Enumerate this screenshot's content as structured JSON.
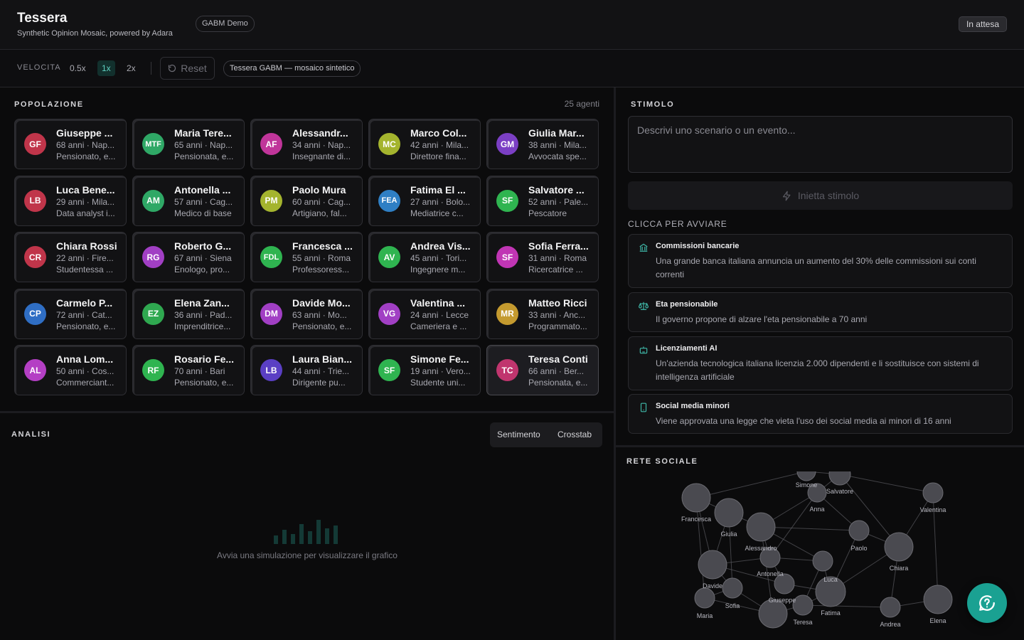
{
  "header": {
    "title": "Tessera",
    "subtitle": "Synthetic Opinion Mosaic, powered by Adara",
    "badge": "GABM Demo",
    "status": "In attesa"
  },
  "toolbar": {
    "speed_label": "VELOCITA",
    "speeds": [
      "0.5x",
      "1x",
      "2x"
    ],
    "active_speed": "1x",
    "reset_label": "Reset",
    "scenario_pill": "Tessera GABM — mosaico sintetico"
  },
  "population": {
    "title": "POPOLAZIONE",
    "count": "25 agenti",
    "agents": [
      {
        "initials": "GF",
        "name": "Giuseppe ...",
        "line1": "68 anni · Nap...",
        "line2": "Pensionato, e...",
        "color": "#c0354a"
      },
      {
        "initials": "MTF",
        "name": "Maria Tere...",
        "line1": "65 anni · Nap...",
        "line2": "Pensionata, e...",
        "color": "#2fa866"
      },
      {
        "initials": "AF",
        "name": "Alessandr...",
        "line1": "34 anni · Nap...",
        "line2": "Insegnante di...",
        "color": "#c0359a"
      },
      {
        "initials": "MC",
        "name": "Marco Col...",
        "line1": "42 anni · Mila...",
        "line2": "Direttore fina...",
        "color": "#a4b42e"
      },
      {
        "initials": "GM",
        "name": "Giulia Mar...",
        "line1": "38 anni · Mila...",
        "line2": "Avvocata spe...",
        "color": "#7b3fc4"
      },
      {
        "initials": "LB",
        "name": "Luca Bene...",
        "line1": "29 anni · Mila...",
        "line2": "Data analyst i...",
        "color": "#c0354a"
      },
      {
        "initials": "AM",
        "name": "Antonella ...",
        "line1": "57 anni · Cag...",
        "line2": "Medico di base",
        "color": "#2fa866"
      },
      {
        "initials": "PM",
        "name": "Paolo Mura",
        "line1": "60 anni · Cag...",
        "line2": "Artigiano, fal...",
        "color": "#a4b42e"
      },
      {
        "initials": "FEA",
        "name": "Fatima El ...",
        "line1": "27 anni · Bolo...",
        "line2": "Mediatrice c...",
        "color": "#2f7fc4"
      },
      {
        "initials": "SF",
        "name": "Salvatore ...",
        "line1": "52 anni · Pale...",
        "line2": "Pescatore",
        "color": "#2fb450"
      },
      {
        "initials": "CR",
        "name": "Chiara Rossi",
        "line1": "22 anni · Fire...",
        "line2": "Studentessa ...",
        "color": "#c0354a"
      },
      {
        "initials": "RG",
        "name": "Roberto G...",
        "line1": "67 anni · Siena",
        "line2": "Enologo, pro...",
        "color": "#a13fc4"
      },
      {
        "initials": "FDL",
        "name": "Francesca ...",
        "line1": "55 anni · Roma",
        "line2": "Professoress...",
        "color": "#2fb450"
      },
      {
        "initials": "AV",
        "name": "Andrea Vis...",
        "line1": "45 anni · Tori...",
        "line2": "Ingegnere m...",
        "color": "#2fb450"
      },
      {
        "initials": "SF",
        "name": "Sofia Ferra...",
        "line1": "31 anni · Roma",
        "line2": "Ricercatrice ...",
        "color": "#c035b4"
      },
      {
        "initials": "CP",
        "name": "Carmelo P...",
        "line1": "72 anni · Cat...",
        "line2": "Pensionato, e...",
        "color": "#2f6ec4"
      },
      {
        "initials": "EZ",
        "name": "Elena Zan...",
        "line1": "36 anni · Pad...",
        "line2": "Imprenditrice...",
        "color": "#2fa850"
      },
      {
        "initials": "DM",
        "name": "Davide Mo...",
        "line1": "63 anni · Mo...",
        "line2": "Pensionato, e...",
        "color": "#a13fc4"
      },
      {
        "initials": "VG",
        "name": "Valentina ...",
        "line1": "24 anni · Lecce",
        "line2": "Cameriera e ...",
        "color": "#a13fc4"
      },
      {
        "initials": "MR",
        "name": "Matteo Ricci",
        "line1": "33 anni · Anc...",
        "line2": "Programmato...",
        "color": "#c49a2f"
      },
      {
        "initials": "AL",
        "name": "Anna Lom...",
        "line1": "50 anni · Cos...",
        "line2": "Commerciant...",
        "color": "#b43fc4"
      },
      {
        "initials": "RF",
        "name": "Rosario Fe...",
        "line1": "70 anni · Bari",
        "line2": "Pensionato, e...",
        "color": "#2fb450"
      },
      {
        "initials": "LB",
        "name": "Laura Bian...",
        "line1": "44 anni · Trie...",
        "line2": "Dirigente pu...",
        "color": "#5a3fc4"
      },
      {
        "initials": "SF",
        "name": "Simone Fe...",
        "line1": "19 anni · Vero...",
        "line2": "Studente uni...",
        "color": "#2fb450"
      },
      {
        "initials": "TC",
        "name": "Teresa Conti",
        "line1": "66 anni · Ber...",
        "line2": "Pensionata, e...",
        "color": "#c0356e"
      }
    ]
  },
  "analysis": {
    "title": "ANALISI",
    "tabs": [
      "Sentimento",
      "Crosstab"
    ],
    "empty_text": "Avvia una simulazione per visualizzare il grafico"
  },
  "stimulus": {
    "title": "STIMOLO",
    "placeholder": "Descrivi uno scenario o un evento...",
    "inject_label": "Inietta stimolo",
    "click_label": "CLICCA PER AVVIARE",
    "scenarios": [
      {
        "icon": "bank-icon",
        "title": "Commissioni bancarie",
        "desc": "Una grande banca italiana annuncia un aumento del 30% delle commissioni sui conti correnti"
      },
      {
        "icon": "scale-icon",
        "title": "Eta pensionabile",
        "desc": "Il governo propone di alzare l'eta pensionabile a 70 anni"
      },
      {
        "icon": "robot-icon",
        "title": "Licenziamenti AI",
        "desc": "Un'azienda tecnologica italiana licenzia 2.000 dipendenti e li sostituisce con sistemi di intelligenza artificiale"
      },
      {
        "icon": "phone-icon",
        "title": "Social media minori",
        "desc": "Viene approvata una legge che vieta l'uso dei social media ai minori di 16 anni"
      }
    ]
  },
  "network": {
    "title": "RETE SOCIALE",
    "labels": [
      "Simone",
      "Salvatore",
      "Anna",
      "Valentina",
      "Francesca",
      "Giulia",
      "Alessandro",
      "Paolo",
      "Chiara",
      "Antonella",
      "Davide",
      "Luca",
      "Sofia",
      "Giuseppe",
      "Maria",
      "Fatima",
      "Teresa",
      "Andrea",
      "Elena"
    ]
  },
  "colors": {
    "accent": "#1aa192",
    "background": "#0b0b0c"
  }
}
